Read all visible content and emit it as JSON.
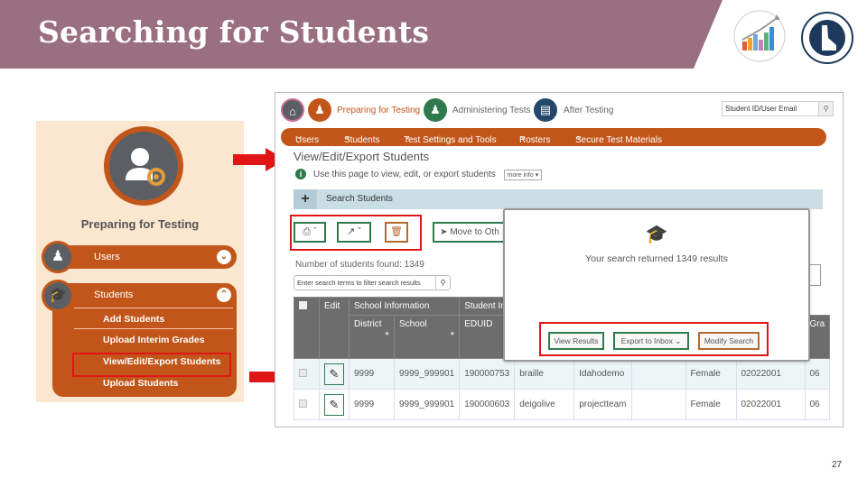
{
  "slide": {
    "title": "Searching for Students",
    "page_number": "27",
    "logos": [
      "idaho-comprehensive-assessment-program-logo",
      "idaho-department-of-education-seal"
    ]
  },
  "left_panel": {
    "title": "Preparing for Testing",
    "icon": "user-gear-icon",
    "menu": [
      {
        "label": "Users",
        "icon": "users-icon",
        "state": "collapsed"
      },
      {
        "label": "Students",
        "icon": "graduation-cap-icon",
        "state": "expanded",
        "items": [
          "Add Students",
          "Upload Interim Grades",
          "View/Edit/Export Students",
          "Upload Students"
        ],
        "highlighted_item": "View/Edit/Export Students"
      }
    ]
  },
  "app": {
    "top_nav": {
      "home_icon": "home-icon",
      "items": [
        {
          "label": "Preparing for Testing",
          "active": true,
          "icon": "user-gear-icon"
        },
        {
          "label": "Administering Tests",
          "active": false,
          "icon": "test-admin-icon"
        },
        {
          "label": "After Testing",
          "active": false,
          "icon": "report-icon"
        }
      ],
      "search_placeholder": "Student ID/User Email"
    },
    "menu_bar": [
      "Users",
      "Students",
      "Test Settings and Tools",
      "Rosters",
      "Secure Test Materials"
    ],
    "page_title": "View/Edit/Export Students",
    "info_text": "Use this page to view, edit, or export students",
    "more_info_label": "more info",
    "search_panel_label": "Search Students",
    "toolbar": {
      "print_icon": "print-icon",
      "export_icon": "export-icon",
      "delete_icon": "trash-icon",
      "move_label": "Move to Oth"
    },
    "students_found": "Number of students found: 1349",
    "filter_placeholder": "Enter search terms to filter search results",
    "table": {
      "group_headers": [
        "Edit",
        "School Information",
        "Student Inf"
      ],
      "sub_headers": [
        "District",
        "School",
        "EDUID"
      ],
      "partial_header": "Gra",
      "rows": [
        {
          "district": "9999",
          "school": "9999_999901",
          "eduid": "190000753",
          "c4": "braille",
          "c5": "Idahodemo",
          "c6": "",
          "gender": "Female",
          "c8": "02022001",
          "c9": "06"
        },
        {
          "district": "9999",
          "school": "9999_999901",
          "eduid": "190000603",
          "c4": "deigolive",
          "c5": "projectteam",
          "c6": "",
          "gender": "Female",
          "c8": "02022001",
          "c9": "06"
        }
      ]
    },
    "modal": {
      "icon": "graduation-cap-icon",
      "message": "Your search returned 1349 results",
      "buttons": [
        "View Results",
        "Export to Inbox",
        "Modify Search"
      ]
    }
  },
  "colors": {
    "header_band": "#9a6f80",
    "brand_orange": "#c2561a",
    "green_accent": "#2f7a4d",
    "highlight_red": "#e01515",
    "panel_bg": "#fbe6cf"
  }
}
